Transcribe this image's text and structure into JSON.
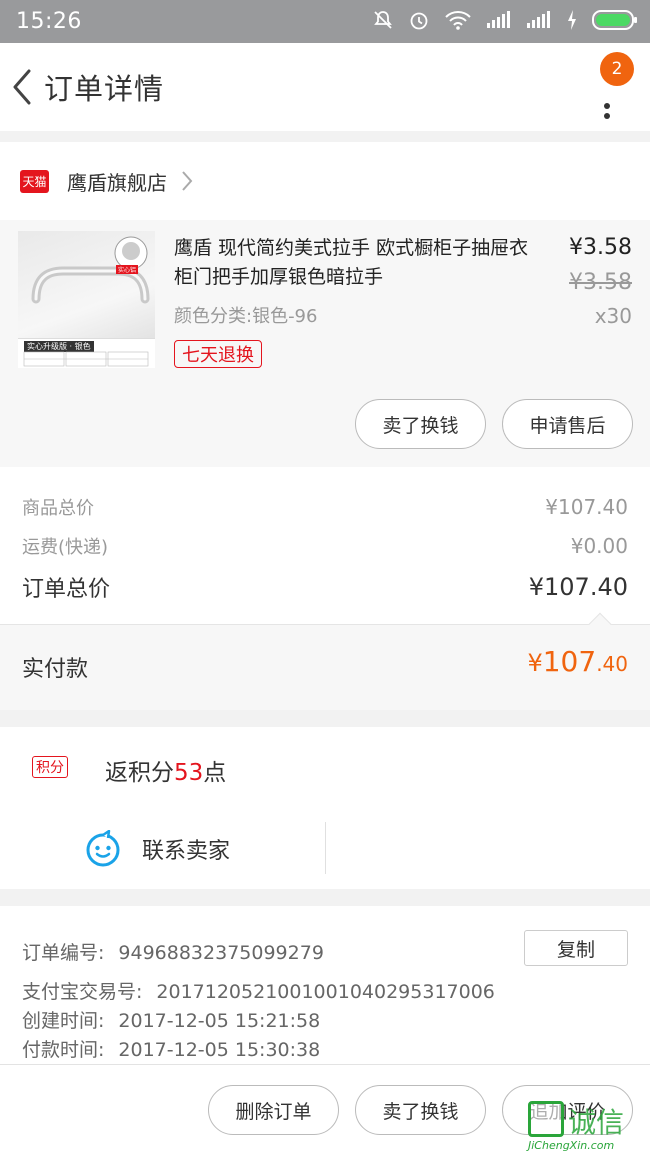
{
  "status_bar": {
    "time": "15:26",
    "icons": [
      "mute-icon",
      "alarm-icon",
      "wifi-icon",
      "signal-icon",
      "signal-icon",
      "charging-icon",
      "battery-icon"
    ]
  },
  "header": {
    "title": "订单详情",
    "badge_count": "2"
  },
  "shop": {
    "badge": "天猫",
    "name": "鹰盾旗舰店"
  },
  "product": {
    "title": "鹰盾 现代简约美式拉手 欧式橱柜子抽屉衣柜门把手加厚银色暗拉手",
    "spec": "颜色分类:银色-96",
    "return_tag": "七天退换",
    "price": "¥3.58",
    "original_price": "¥3.58",
    "quantity": "x30",
    "image_labels": [
      "实心铝",
      "实心升级版 · 银色"
    ],
    "buttons": {
      "sell": "卖了换钱",
      "after_sales": "申请售后"
    }
  },
  "summary": {
    "goods_total_label": "商品总价",
    "goods_total": "¥107.40",
    "shipping_label": "运费(快递)",
    "shipping": "¥0.00",
    "order_total_label": "订单总价",
    "order_total": "¥107.40",
    "paid_label": "实付款",
    "paid_currency": "¥",
    "paid_int": "107",
    "paid_dec": ".40"
  },
  "points": {
    "badge": "积分",
    "prefix": "返积分",
    "value": "53",
    "suffix": "点"
  },
  "contact": {
    "label": "联系卖家"
  },
  "order_info": {
    "order_no_label": "订单编号:",
    "order_no": "94968832375099279",
    "copy_label": "复制",
    "alipay_label": "支付宝交易号:",
    "alipay_no": "2017120521001001040295317006",
    "created_label": "创建时间:",
    "created": "2017-12-05 15:21:58",
    "paid_label": "付款时间:",
    "paid": "2017-12-05 15:30:38"
  },
  "bottom_bar": {
    "delete": "删除订单",
    "sell": "卖了换钱",
    "review": "追加评价"
  },
  "watermark": {
    "text": "诚信",
    "site": "JiChengXin.com"
  },
  "colors": {
    "accent": "#f0640f",
    "tmall_red": "#e4151e",
    "status_bar": "#999a9c",
    "contact_blue": "#1aa3e8"
  }
}
